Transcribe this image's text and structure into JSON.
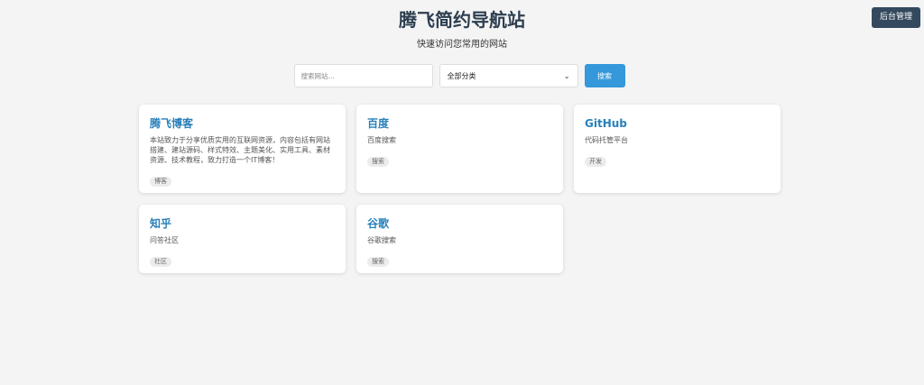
{
  "header": {
    "title": "腾飞简约导航站",
    "subtitle": "快速访问您常用的网站"
  },
  "admin_button": "后台管理",
  "search": {
    "placeholder": "搜索网站...",
    "category_selected": "全部分类",
    "button_label": "搜索"
  },
  "sites": [
    {
      "title": "腾飞博客",
      "desc": "本站致力于分享优质实用的互联网资源，内容包括有网站搭建、建站源码、样式特效、主题美化、实用工具、素材资源、技术教程，致力打造一个IT博客！",
      "tag": "博客"
    },
    {
      "title": "百度",
      "desc": "百度搜索",
      "tag": "搜索"
    },
    {
      "title": "GitHub",
      "desc": "代码托管平台",
      "tag": "开发"
    },
    {
      "title": "知乎",
      "desc": "问答社区",
      "tag": "社区"
    },
    {
      "title": "谷歌",
      "desc": "谷歌搜索",
      "tag": "搜索"
    }
  ],
  "colors": {
    "accent": "#3498db",
    "admin": "#34495e",
    "link_title": "#2980b9",
    "background": "#f4f4f4"
  }
}
